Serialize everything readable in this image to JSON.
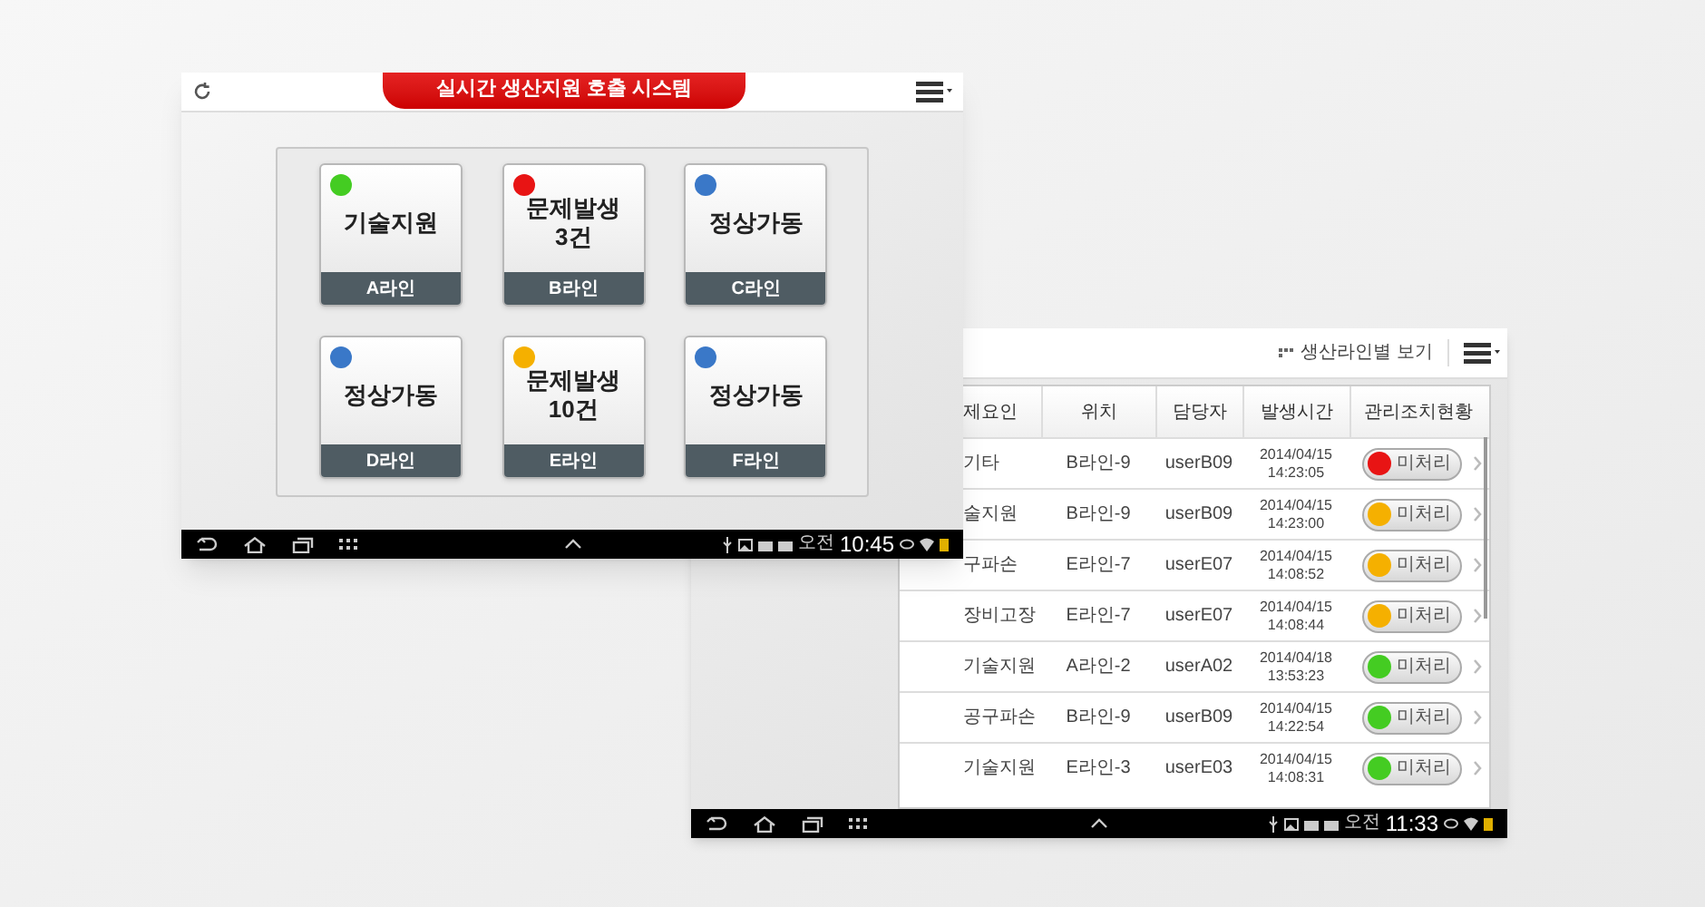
{
  "dashboard": {
    "title": "실시간 생산지원 호출 시스템",
    "tiles": [
      {
        "status": "기술지원",
        "line": "A라인",
        "color": "#44cc22"
      },
      {
        "status": "문제발생",
        "count": "3건",
        "line": "B라인",
        "color": "#e81414"
      },
      {
        "status": "정상가동",
        "line": "C라인",
        "color": "#3a78c8"
      },
      {
        "status": "정상가동",
        "line": "D라인",
        "color": "#3a78c8"
      },
      {
        "status": "문제발생",
        "count": "10건",
        "line": "E라인",
        "color": "#f5b000"
      },
      {
        "status": "정상가동",
        "line": "F라인",
        "color": "#3a78c8"
      }
    ],
    "nav_bar": {
      "am_pm": "오전",
      "time": "10:45"
    }
  },
  "issue_list": {
    "view_button": "생산라인별 보기",
    "columns": [
      "제요인",
      "위치",
      "담당자",
      "발생시간",
      "관리조치현황"
    ],
    "rows": [
      {
        "cause": "기타",
        "location": "B라인-9",
        "assignee": "userB09",
        "date": "2014/04/15",
        "time": "14:23:05",
        "status": "미처리",
        "color": "#e81414"
      },
      {
        "cause": "술지원",
        "location": "B라인-9",
        "assignee": "userB09",
        "date": "2014/04/15",
        "time": "14:23:00",
        "status": "미처리",
        "color": "#f5b000"
      },
      {
        "cause": "구파손",
        "location": "E라인-7",
        "assignee": "userE07",
        "date": "2014/04/15",
        "time": "14:08:52",
        "status": "미처리",
        "color": "#f5b000"
      },
      {
        "cause": "장비고장",
        "location": "E라인-7",
        "assignee": "userE07",
        "date": "2014/04/15",
        "time": "14:08:44",
        "status": "미처리",
        "color": "#f5b000"
      },
      {
        "cause": "기술지원",
        "location": "A라인-2",
        "assignee": "userA02",
        "date": "2014/04/18",
        "time": "13:53:23",
        "status": "미처리",
        "color": "#44cc22"
      },
      {
        "cause": "공구파손",
        "location": "B라인-9",
        "assignee": "userB09",
        "date": "2014/04/15",
        "time": "14:22:54",
        "status": "미처리",
        "color": "#44cc22"
      },
      {
        "cause": "기술지원",
        "location": "E라인-3",
        "assignee": "userE03",
        "date": "2014/04/15",
        "time": "14:08:31",
        "status": "미처리",
        "color": "#44cc22"
      }
    ],
    "nav_bar": {
      "am_pm": "오전",
      "time": "11:33"
    }
  }
}
